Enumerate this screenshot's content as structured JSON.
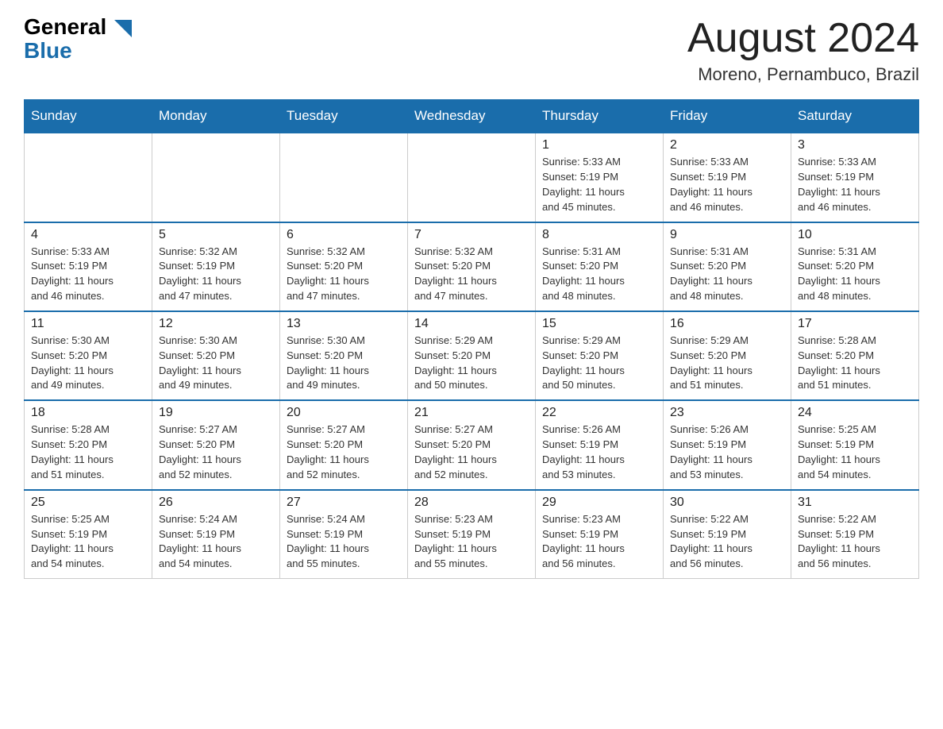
{
  "header": {
    "logo": {
      "general": "General",
      "blue": "Blue"
    },
    "title": "August 2024",
    "location": "Moreno, Pernambuco, Brazil"
  },
  "weekdays": [
    "Sunday",
    "Monday",
    "Tuesday",
    "Wednesday",
    "Thursday",
    "Friday",
    "Saturday"
  ],
  "weeks": [
    [
      {
        "day": "",
        "info": ""
      },
      {
        "day": "",
        "info": ""
      },
      {
        "day": "",
        "info": ""
      },
      {
        "day": "",
        "info": ""
      },
      {
        "day": "1",
        "info": "Sunrise: 5:33 AM\nSunset: 5:19 PM\nDaylight: 11 hours\nand 45 minutes."
      },
      {
        "day": "2",
        "info": "Sunrise: 5:33 AM\nSunset: 5:19 PM\nDaylight: 11 hours\nand 46 minutes."
      },
      {
        "day": "3",
        "info": "Sunrise: 5:33 AM\nSunset: 5:19 PM\nDaylight: 11 hours\nand 46 minutes."
      }
    ],
    [
      {
        "day": "4",
        "info": "Sunrise: 5:33 AM\nSunset: 5:19 PM\nDaylight: 11 hours\nand 46 minutes."
      },
      {
        "day": "5",
        "info": "Sunrise: 5:32 AM\nSunset: 5:19 PM\nDaylight: 11 hours\nand 47 minutes."
      },
      {
        "day": "6",
        "info": "Sunrise: 5:32 AM\nSunset: 5:20 PM\nDaylight: 11 hours\nand 47 minutes."
      },
      {
        "day": "7",
        "info": "Sunrise: 5:32 AM\nSunset: 5:20 PM\nDaylight: 11 hours\nand 47 minutes."
      },
      {
        "day": "8",
        "info": "Sunrise: 5:31 AM\nSunset: 5:20 PM\nDaylight: 11 hours\nand 48 minutes."
      },
      {
        "day": "9",
        "info": "Sunrise: 5:31 AM\nSunset: 5:20 PM\nDaylight: 11 hours\nand 48 minutes."
      },
      {
        "day": "10",
        "info": "Sunrise: 5:31 AM\nSunset: 5:20 PM\nDaylight: 11 hours\nand 48 minutes."
      }
    ],
    [
      {
        "day": "11",
        "info": "Sunrise: 5:30 AM\nSunset: 5:20 PM\nDaylight: 11 hours\nand 49 minutes."
      },
      {
        "day": "12",
        "info": "Sunrise: 5:30 AM\nSunset: 5:20 PM\nDaylight: 11 hours\nand 49 minutes."
      },
      {
        "day": "13",
        "info": "Sunrise: 5:30 AM\nSunset: 5:20 PM\nDaylight: 11 hours\nand 49 minutes."
      },
      {
        "day": "14",
        "info": "Sunrise: 5:29 AM\nSunset: 5:20 PM\nDaylight: 11 hours\nand 50 minutes."
      },
      {
        "day": "15",
        "info": "Sunrise: 5:29 AM\nSunset: 5:20 PM\nDaylight: 11 hours\nand 50 minutes."
      },
      {
        "day": "16",
        "info": "Sunrise: 5:29 AM\nSunset: 5:20 PM\nDaylight: 11 hours\nand 51 minutes."
      },
      {
        "day": "17",
        "info": "Sunrise: 5:28 AM\nSunset: 5:20 PM\nDaylight: 11 hours\nand 51 minutes."
      }
    ],
    [
      {
        "day": "18",
        "info": "Sunrise: 5:28 AM\nSunset: 5:20 PM\nDaylight: 11 hours\nand 51 minutes."
      },
      {
        "day": "19",
        "info": "Sunrise: 5:27 AM\nSunset: 5:20 PM\nDaylight: 11 hours\nand 52 minutes."
      },
      {
        "day": "20",
        "info": "Sunrise: 5:27 AM\nSunset: 5:20 PM\nDaylight: 11 hours\nand 52 minutes."
      },
      {
        "day": "21",
        "info": "Sunrise: 5:27 AM\nSunset: 5:20 PM\nDaylight: 11 hours\nand 52 minutes."
      },
      {
        "day": "22",
        "info": "Sunrise: 5:26 AM\nSunset: 5:19 PM\nDaylight: 11 hours\nand 53 minutes."
      },
      {
        "day": "23",
        "info": "Sunrise: 5:26 AM\nSunset: 5:19 PM\nDaylight: 11 hours\nand 53 minutes."
      },
      {
        "day": "24",
        "info": "Sunrise: 5:25 AM\nSunset: 5:19 PM\nDaylight: 11 hours\nand 54 minutes."
      }
    ],
    [
      {
        "day": "25",
        "info": "Sunrise: 5:25 AM\nSunset: 5:19 PM\nDaylight: 11 hours\nand 54 minutes."
      },
      {
        "day": "26",
        "info": "Sunrise: 5:24 AM\nSunset: 5:19 PM\nDaylight: 11 hours\nand 54 minutes."
      },
      {
        "day": "27",
        "info": "Sunrise: 5:24 AM\nSunset: 5:19 PM\nDaylight: 11 hours\nand 55 minutes."
      },
      {
        "day": "28",
        "info": "Sunrise: 5:23 AM\nSunset: 5:19 PM\nDaylight: 11 hours\nand 55 minutes."
      },
      {
        "day": "29",
        "info": "Sunrise: 5:23 AM\nSunset: 5:19 PM\nDaylight: 11 hours\nand 56 minutes."
      },
      {
        "day": "30",
        "info": "Sunrise: 5:22 AM\nSunset: 5:19 PM\nDaylight: 11 hours\nand 56 minutes."
      },
      {
        "day": "31",
        "info": "Sunrise: 5:22 AM\nSunset: 5:19 PM\nDaylight: 11 hours\nand 56 minutes."
      }
    ]
  ]
}
